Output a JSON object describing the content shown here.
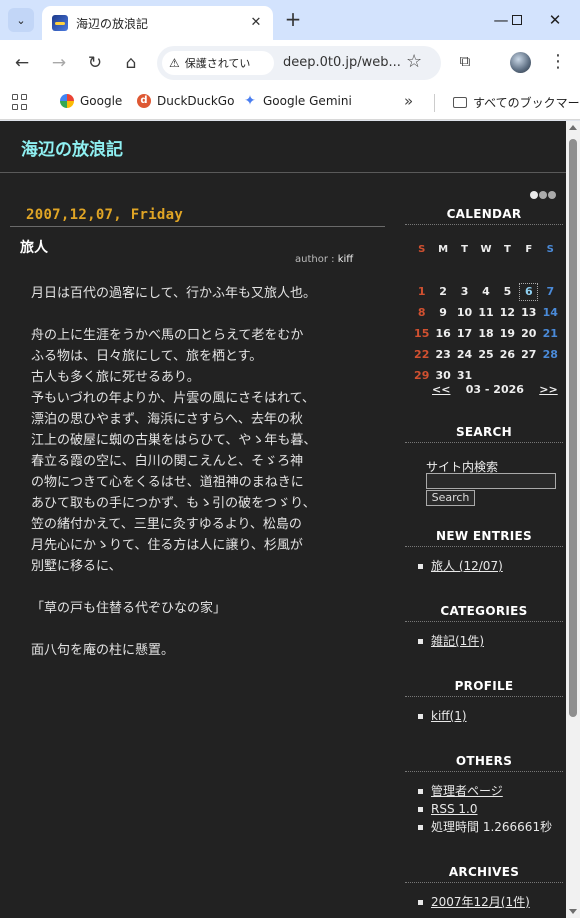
{
  "browser": {
    "tab_title": "海辺の放浪記",
    "security_label": "保護されてい",
    "url": "deep.0t0.jp/web...",
    "bookmarks": [
      {
        "label": "Google"
      },
      {
        "label": "DuckDuckGo"
      },
      {
        "label": "Google Gemini"
      }
    ],
    "all_bookmarks_label": "すべてのブックマーク"
  },
  "site": {
    "title": "海辺の放浪記"
  },
  "entry": {
    "date": "2007,12,07, Friday",
    "title": "旅人",
    "author_prefix": "author : ",
    "author_name": "kiff",
    "body_lines": [
      "月日は百代の過客にして、行かふ年も又旅人也。",
      "",
      "舟の上に生涯をうかべ馬の口とらえて老をむか",
      "ふる物は、日々旅にして、旅を栖とす。",
      "古人も多く旅に死せるあり。",
      "予もいづれの年よりか、片雲の風にさそはれて、",
      "漂泊の思ひやまず、海浜にさすらへ、去年の秋",
      "江上の破屋に蜘の古巣をはらひて、やゝ年も暮、",
      "春立る霞の空に、白川の関こえんと、そゞろ神",
      "の物につきて心をくるはせ、道祖神のまねきに",
      "あひて取もの手につかず、もゝ引の破をつゞり、",
      "笠の緒付かえて、三里に灸すゆるより、松島の",
      "月先心にかゝりて、住る方は人に譲り、杉風が",
      "別墅に移るに、",
      "",
      "「草の戸も住替る代ぞひなの家」",
      "",
      "面八句を庵の柱に懸置。"
    ]
  },
  "sidebar": {
    "calendar": {
      "heading": "CALENDAR",
      "weekdays": [
        "S",
        "M",
        "T",
        "W",
        "T",
        "F",
        "S"
      ],
      "weeks": [
        [
          "",
          "",
          "",
          "",
          "",
          "",
          ""
        ],
        [
          "1",
          "2",
          "3",
          "4",
          "5",
          "6",
          "7"
        ],
        [
          "8",
          "9",
          "10",
          "11",
          "12",
          "13",
          "14"
        ],
        [
          "15",
          "16",
          "17",
          "18",
          "19",
          "20",
          "21"
        ],
        [
          "22",
          "23",
          "24",
          "25",
          "26",
          "27",
          "28"
        ],
        [
          "29",
          "30",
          "31",
          "",
          "",
          "",
          ""
        ]
      ],
      "today": "6",
      "prev": "<<",
      "month_label": "03 - 2026",
      "next": ">>"
    },
    "search": {
      "heading": "SEARCH",
      "label": "サイト内検索",
      "value": "",
      "button": "Search"
    },
    "new_entries": {
      "heading": "NEW ENTRIES",
      "items": [
        "旅人 (12/07)"
      ]
    },
    "categories": {
      "heading": "CATEGORIES",
      "items": [
        "雑記(1件)"
      ]
    },
    "profile": {
      "heading": "PROFILE",
      "items": [
        "kiff(1)"
      ]
    },
    "others": {
      "heading": "OTHERS",
      "admin": "管理者ページ",
      "rss": "RSS 1.0",
      "processing": "処理時間 1.266661秒"
    },
    "archives": {
      "heading": "ARCHIVES",
      "items": [
        "2007年12月(1件)"
      ]
    }
  }
}
